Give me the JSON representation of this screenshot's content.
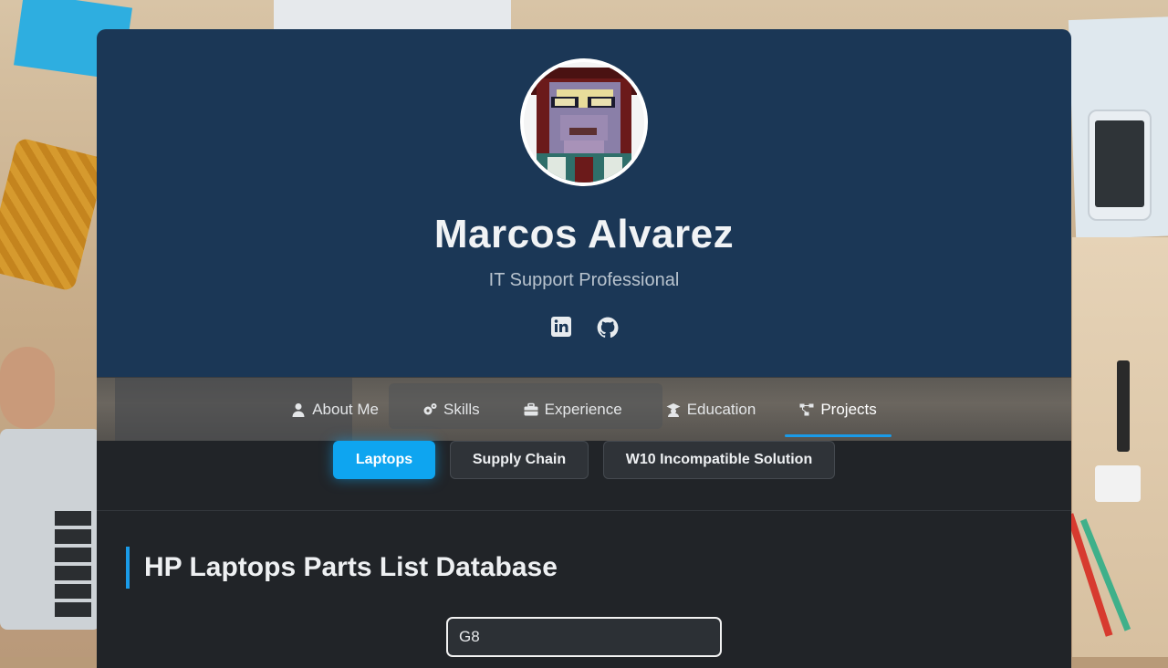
{
  "profile": {
    "name": "Marcos Alvarez",
    "role": "IT Support Professional",
    "socials": [
      {
        "icon": "linkedin-icon"
      },
      {
        "icon": "github-icon"
      }
    ]
  },
  "nav": {
    "items": [
      {
        "label": "About Me",
        "icon": "user-icon",
        "active": false
      },
      {
        "label": "Skills",
        "icon": "gears-icon",
        "active": false
      },
      {
        "label": "Experience",
        "icon": "briefcase-icon",
        "active": false
      },
      {
        "label": "Education",
        "icon": "graduate-icon",
        "active": false
      },
      {
        "label": "Projects",
        "icon": "project-diagram-icon",
        "active": true
      }
    ]
  },
  "projects": {
    "tabs": [
      {
        "label": "Laptops",
        "active": true
      },
      {
        "label": "Supply Chain",
        "active": false
      },
      {
        "label": "W10 Incompatible Solution",
        "active": false
      }
    ],
    "section_title": "HP Laptops Parts List Database",
    "search": {
      "value": "G8"
    }
  },
  "colors": {
    "header_bg": "#1b3756",
    "content_bg": "#212428",
    "accent": "#0ea5f0"
  }
}
